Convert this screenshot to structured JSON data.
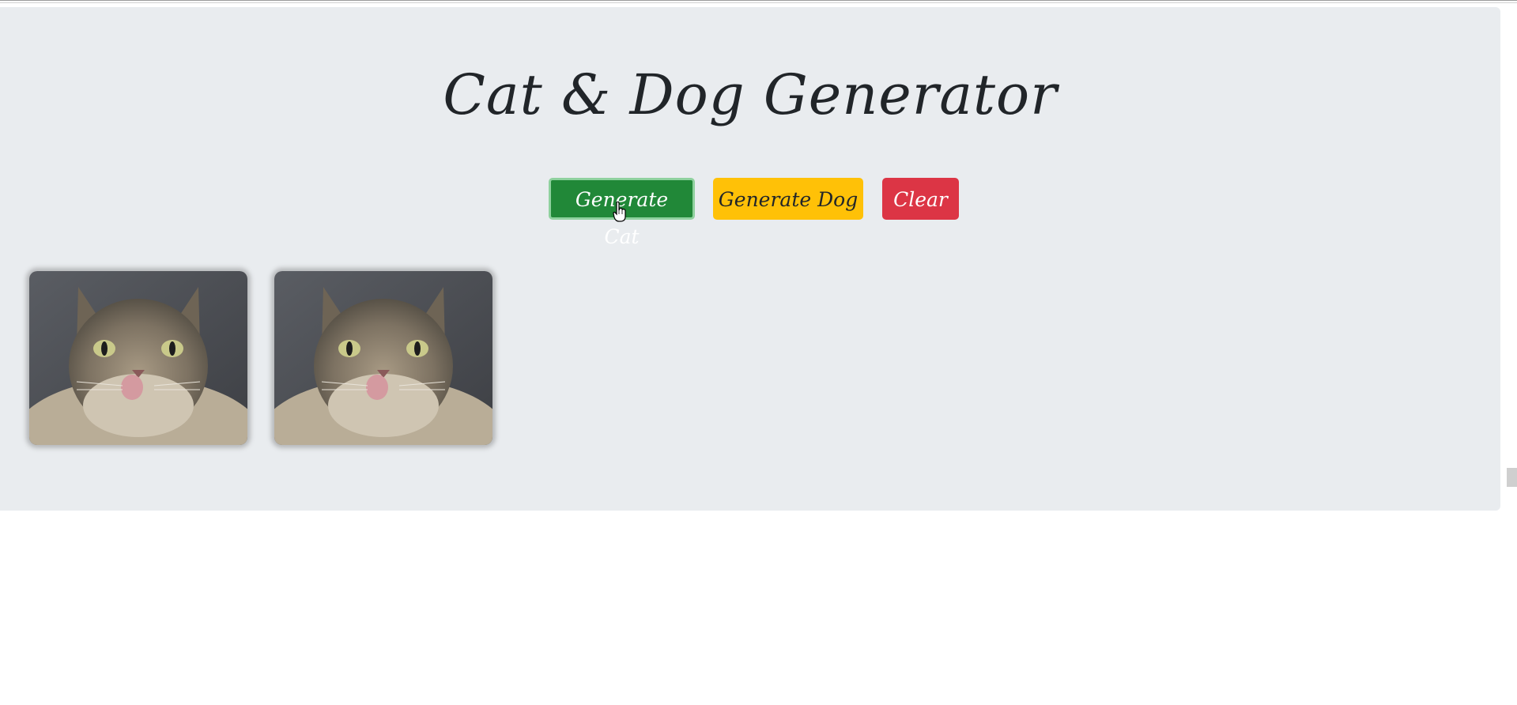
{
  "header": {
    "title": "Cat & Dog Generator"
  },
  "buttons": {
    "generate_cat": "Generate Cat",
    "generate_dog": "Generate Dog",
    "clear": "Clear"
  },
  "colors": {
    "cat_button": "#218838",
    "dog_button": "#ffc107",
    "clear_button": "#dc3545",
    "jumbotron_bg": "#e9ecef"
  },
  "images": [
    {
      "alt": "cat"
    },
    {
      "alt": "cat"
    }
  ]
}
